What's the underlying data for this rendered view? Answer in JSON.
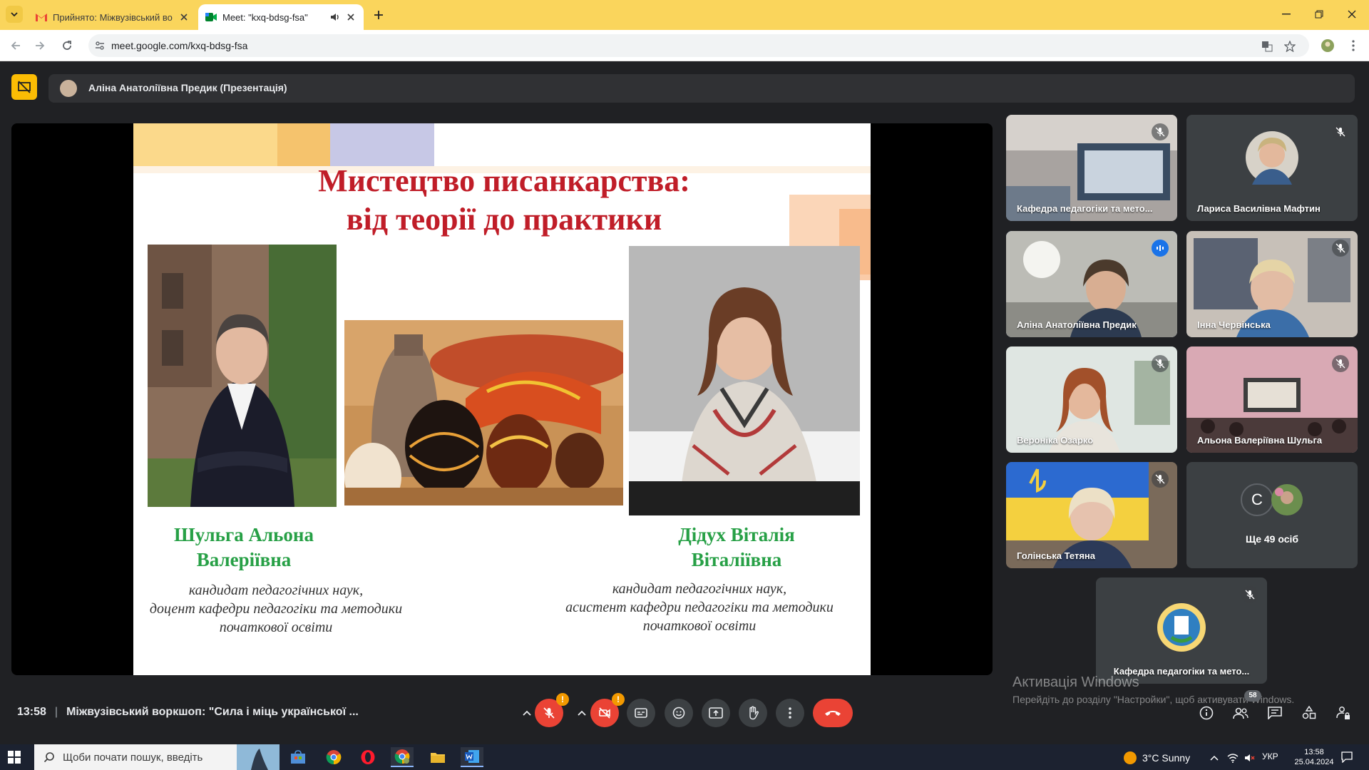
{
  "browser": {
    "tabs": [
      {
        "label": "Прийнято: Міжвузівський во",
        "icon": "gmail-icon",
        "active": false
      },
      {
        "label": "Meet: \"kxq-bdsg-fsa\"",
        "icon": "meet-icon",
        "active": true
      }
    ],
    "url": "meet.google.com/kxq-bdsg-fsa"
  },
  "meet": {
    "presenter_label": "Аліна Анатоліївна Предик (Презентація)",
    "slide": {
      "title_line1": "Мистецтво писанкарства:",
      "title_line2": "від теорії до практики",
      "speaker_left": {
        "name_line1": "Шульга Альона",
        "name_line2": "Валеріївна",
        "role_line1": "кандидат педагогічних наук,",
        "role_line2": "доцент кафедри педагогіки та методики",
        "role_line3": "початкової освіти"
      },
      "speaker_right": {
        "name_line1": "Дідух Віталія",
        "name_line2": "Віталіївна",
        "role_line1": "кандидат педагогічних наук,",
        "role_line2": "асистент кафедри педагогіки та методики",
        "role_line3": "початкової освіти"
      }
    },
    "participants": [
      {
        "name": "Кафедра педагогіки та мето..."
      },
      {
        "name": "Лариса Василівна Мафтин"
      },
      {
        "name": "Аліна Анатоліївна Предик",
        "speaking": true
      },
      {
        "name": "Інна Червінська"
      },
      {
        "name": "Вероніка Озарко"
      },
      {
        "name": "Альона Валеріївна Шульга"
      },
      {
        "name": "Голінська Тетяна"
      },
      {
        "name": "Ще 49 осіб",
        "avatar_letter": "C"
      },
      {
        "name": "Кафедра педагогіки та мето..."
      }
    ],
    "bottom": {
      "time": "13:58",
      "meeting_title": "Міжвузівський воркшоп: \"Сила і міць української ...",
      "participant_count": "58",
      "warning_mark": "!"
    },
    "activation": {
      "line1": "Активація Windows",
      "line2": "Перейдіть до розділу \"Настройки\", щоб активувати Windows."
    }
  },
  "taskbar": {
    "search_placeholder": "Щоби почати пошук, введіть",
    "weather": "3°C  Sunny",
    "lang": "УКР",
    "time": "13:58",
    "date": "25.04.2024"
  },
  "colors": {
    "tab_strip": "#fad55c",
    "meet_bg": "#202124",
    "end_call": "#ea4335",
    "slide_title": "#c01d28",
    "speaker_name": "#27a046"
  }
}
